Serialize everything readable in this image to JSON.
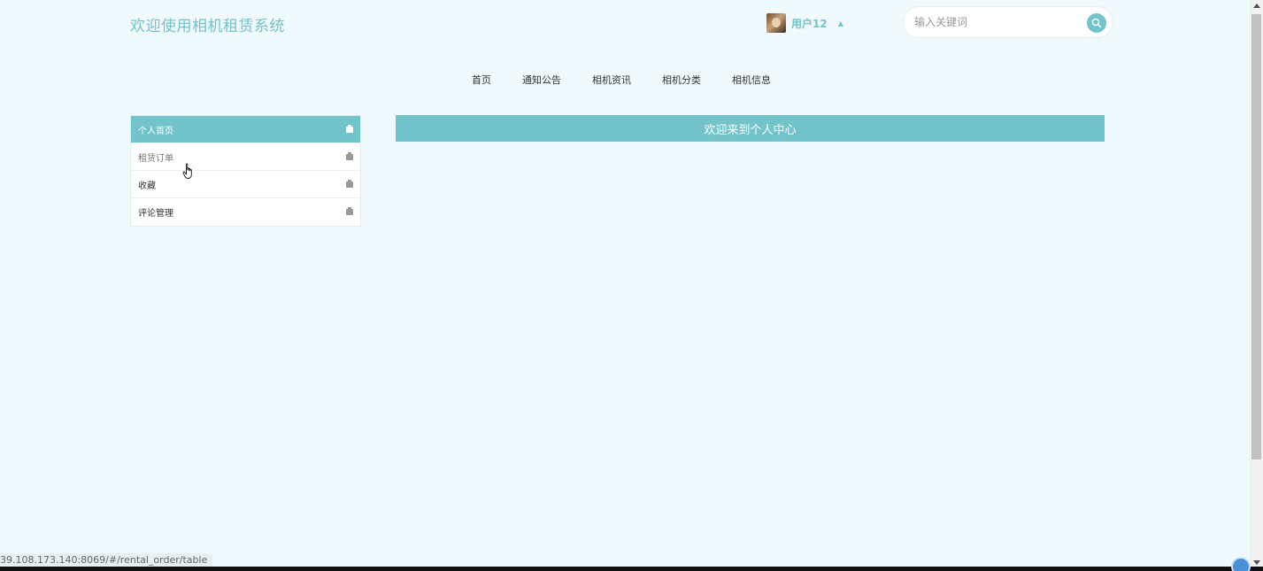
{
  "header": {
    "site_title": "欢迎使用相机租赁系统",
    "user": {
      "name": "用户12",
      "caret": "▲"
    },
    "search": {
      "placeholder": "输入关键词",
      "value": ""
    }
  },
  "nav": {
    "items": [
      {
        "label": "首页"
      },
      {
        "label": "通知公告"
      },
      {
        "label": "相机资讯"
      },
      {
        "label": "相机分类"
      },
      {
        "label": "相机信息"
      }
    ]
  },
  "sidebar": {
    "items": [
      {
        "label": "个人首页",
        "icon": "home-icon",
        "active": true
      },
      {
        "label": "租赁订单",
        "icon": "home-icon",
        "active": false
      },
      {
        "label": "收藏",
        "icon": "home-icon",
        "active": false
      },
      {
        "label": "评论管理",
        "icon": "home-icon",
        "active": false
      }
    ]
  },
  "main": {
    "welcome_text": "欢迎来到个人中心"
  },
  "status_bar": {
    "url": "39.108.173.140:8069/#/rental_order/table"
  },
  "colors": {
    "accent": "#72c3ca",
    "background": "#f0f9fc"
  }
}
